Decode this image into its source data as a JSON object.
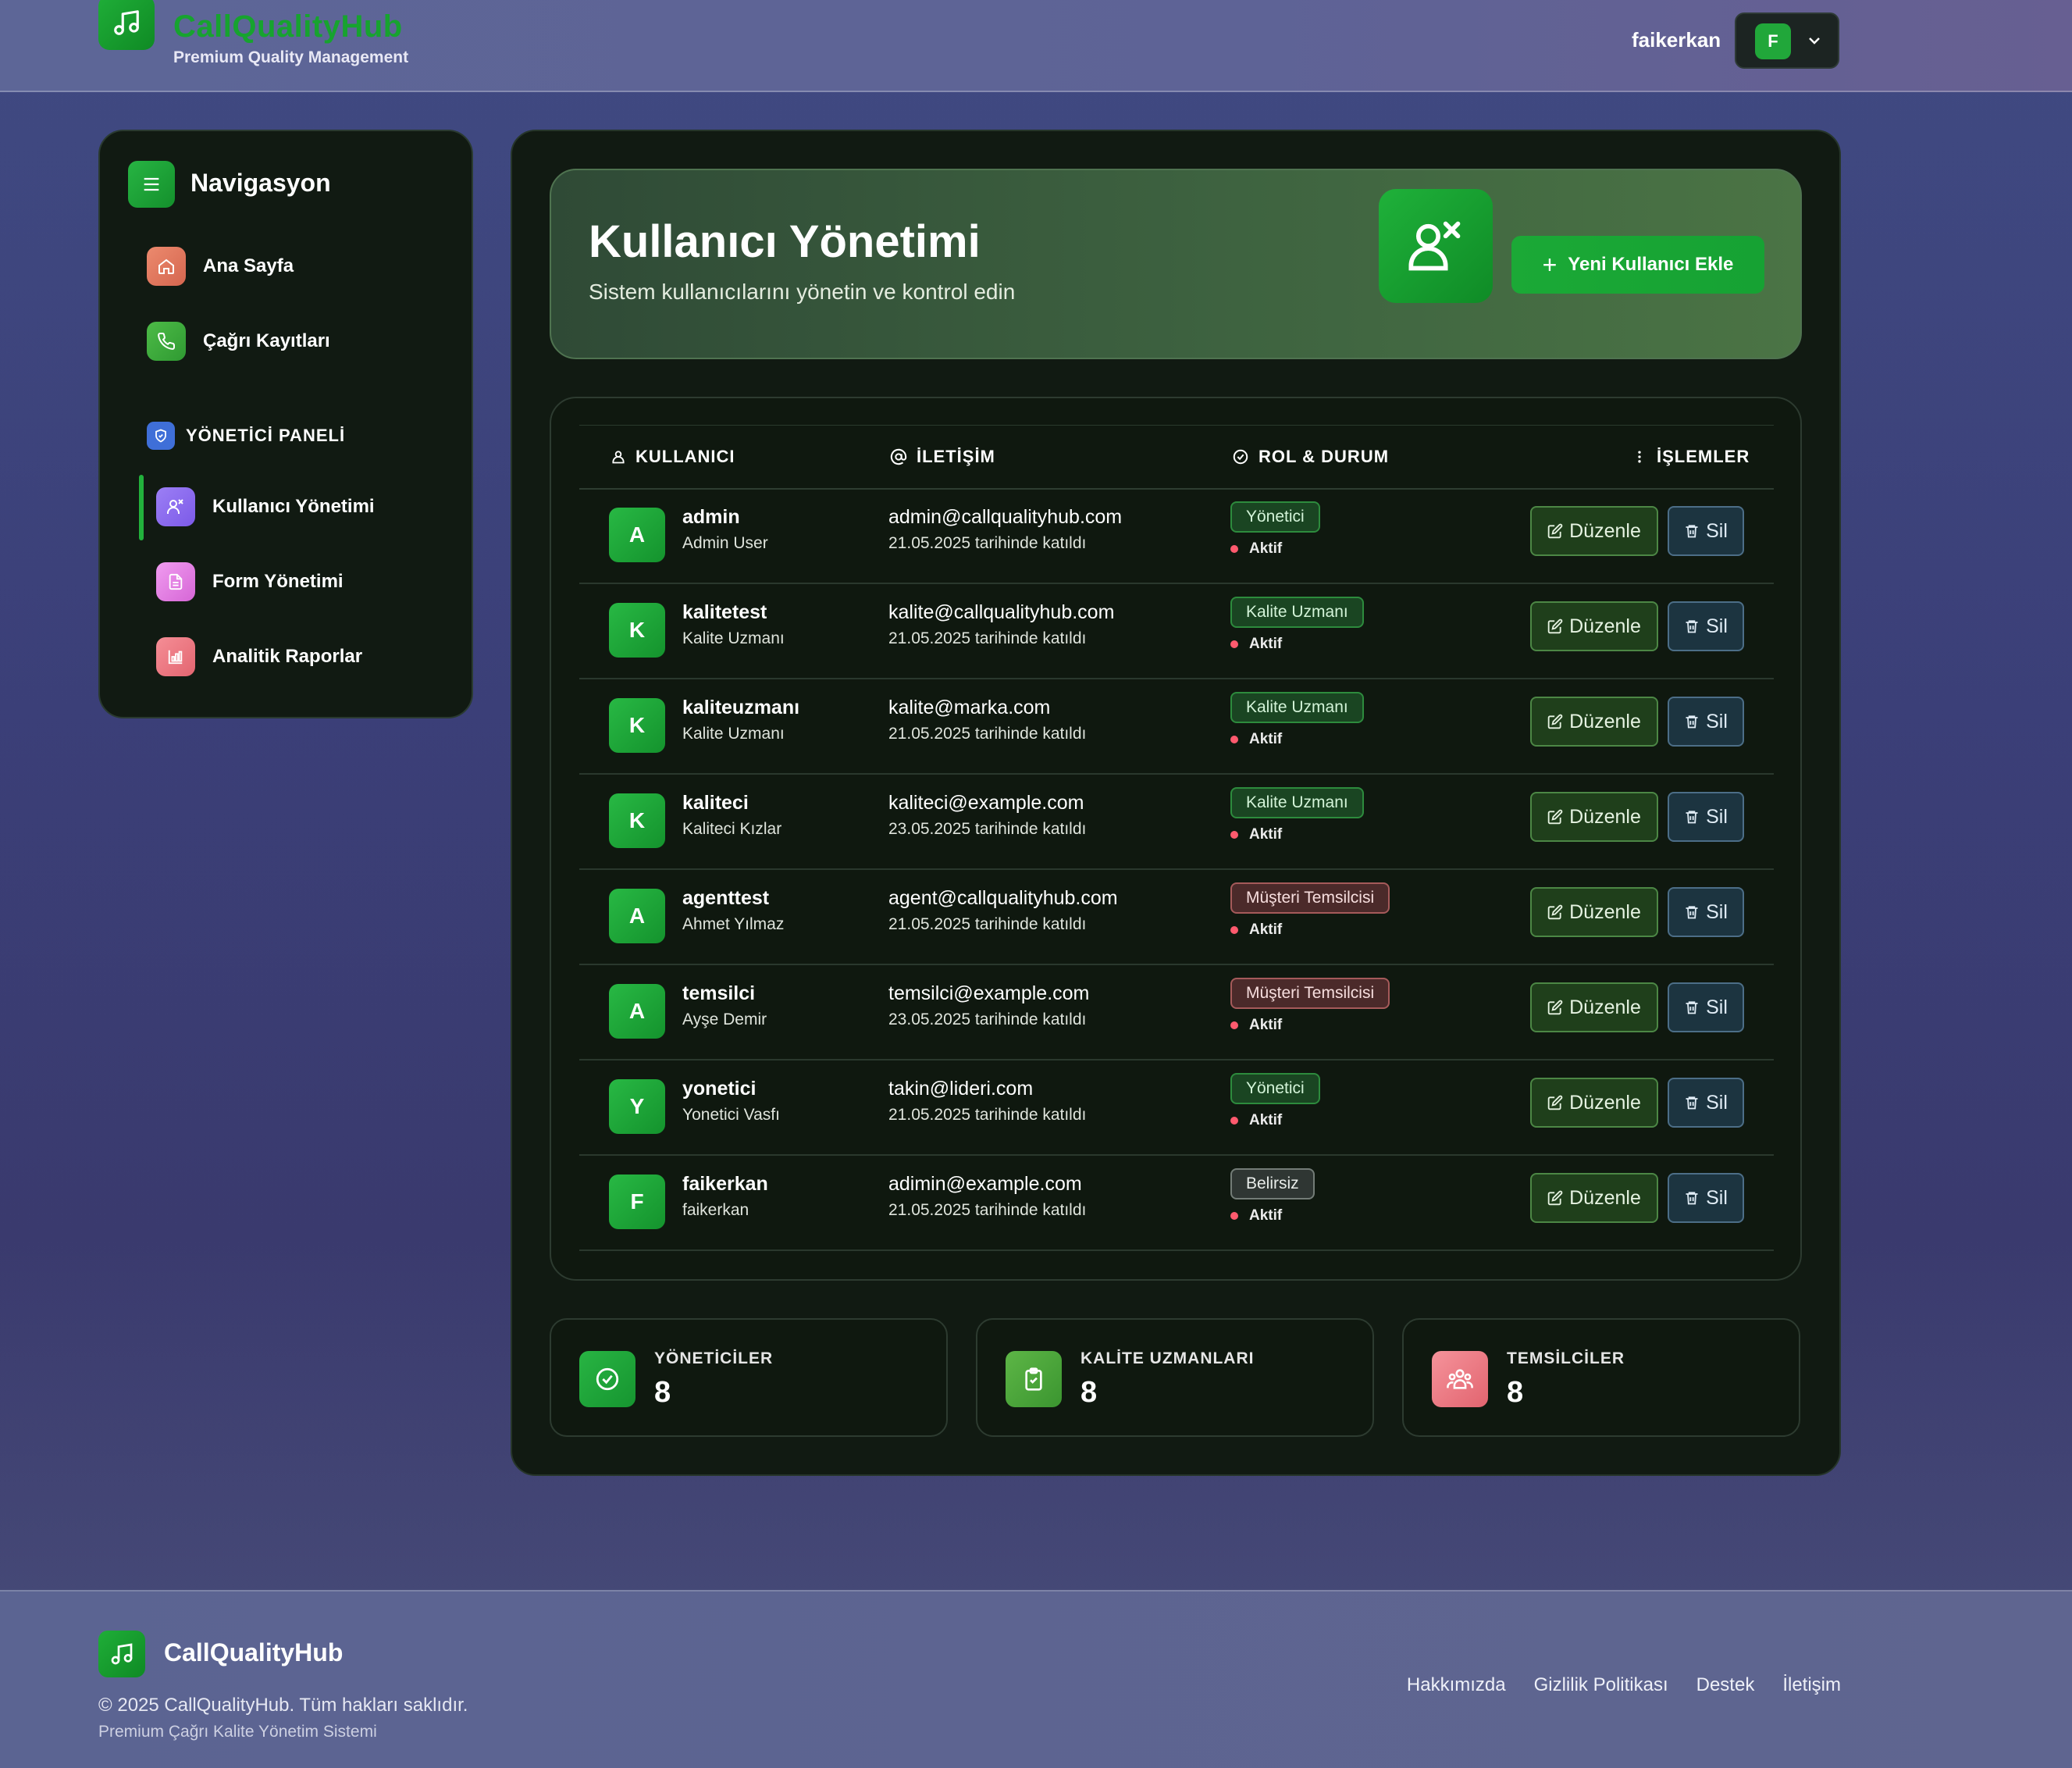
{
  "header": {
    "brand": "CallQualityHub",
    "tagline": "Premium Quality Management",
    "username": "faikerkan",
    "avatar_letter": "F"
  },
  "sidebar": {
    "title": "Navigasyon",
    "items": [
      {
        "label": "Ana Sayfa",
        "icon": "home-icon",
        "color": "#e07a62"
      },
      {
        "label": "Çağrı Kayıtları",
        "icon": "phone-icon",
        "color": "#3daa3e"
      }
    ],
    "section_title": "YÖNETİCİ PANELİ",
    "admin_items": [
      {
        "label": "Kullanıcı Yönetimi",
        "icon": "user-manage-icon",
        "color": "#8b6cf0"
      },
      {
        "label": "Form Yönetimi",
        "icon": "form-icon",
        "color": "#e07be0"
      },
      {
        "label": "Analitik Raporlar",
        "icon": "chart-icon",
        "color": "#ef7b86"
      }
    ]
  },
  "hero": {
    "title": "Kullanıcı Yönetimi",
    "subtitle": "Sistem kullanıcılarını yönetin ve kontrol edin",
    "add_button": "Yeni Kullanıcı Ekle"
  },
  "table": {
    "headers": [
      "KULLANICI",
      "İLETİŞİM",
      "ROL & DURUM",
      "İŞLEMLER"
    ],
    "edit_label": "Düzenle",
    "delete_label": "Sil",
    "rows": [
      {
        "initial": "A",
        "username": "admin",
        "fullname": "Admin User",
        "email": "admin@callqualityhub.com",
        "joined": "21.05.2025 tarihinde katıldı",
        "role": "Yönetici",
        "role_style": "green",
        "status": "Aktif"
      },
      {
        "initial": "K",
        "username": "kalitetest",
        "fullname": "Kalite Uzmanı",
        "email": "kalite@callqualityhub.com",
        "joined": "21.05.2025 tarihinde katıldı",
        "role": "Kalite Uzmanı",
        "role_style": "green",
        "status": "Aktif"
      },
      {
        "initial": "K",
        "username": "kaliteuzmanı",
        "fullname": "Kalite Uzmanı",
        "email": "kalite@marka.com",
        "joined": "21.05.2025 tarihinde katıldı",
        "role": "Kalite Uzmanı",
        "role_style": "green",
        "status": "Aktif"
      },
      {
        "initial": "K",
        "username": "kaliteci",
        "fullname": "Kaliteci Kızlar",
        "email": "kaliteci@example.com",
        "joined": "23.05.2025 tarihinde katıldı",
        "role": "Kalite Uzmanı",
        "role_style": "green",
        "status": "Aktif"
      },
      {
        "initial": "A",
        "username": "agenttest",
        "fullname": "Ahmet Yılmaz",
        "email": "agent@callqualityhub.com",
        "joined": "21.05.2025 tarihinde katıldı",
        "role": "Müşteri Temsilcisi",
        "role_style": "red",
        "status": "Aktif"
      },
      {
        "initial": "A",
        "username": "temsilci",
        "fullname": "Ayşe Demir",
        "email": "temsilci@example.com",
        "joined": "23.05.2025 tarihinde katıldı",
        "role": "Müşteri Temsilcisi",
        "role_style": "red",
        "status": "Aktif"
      },
      {
        "initial": "Y",
        "username": "yonetici",
        "fullname": "Yonetici Vasfı",
        "email": "takin@lideri.com",
        "joined": "21.05.2025 tarihinde katıldı",
        "role": "Yönetici",
        "role_style": "green",
        "status": "Aktif"
      },
      {
        "initial": "F",
        "username": "faikerkan",
        "fullname": "faikerkan",
        "email": "adimin@example.com",
        "joined": "21.05.2025 tarihinde katıldı",
        "role": "Belirsiz",
        "role_style": "gray",
        "status": "Aktif"
      }
    ]
  },
  "stats": [
    {
      "label": "YÖNETİCİLER",
      "value": "8",
      "icon": "shield-check-icon",
      "color": "#23ad3e"
    },
    {
      "label": "KALİTE UZMANLARI",
      "value": "8",
      "icon": "clipboard-icon",
      "color": "#4aa63a"
    },
    {
      "label": "TEMSİLCİLER",
      "value": "8",
      "icon": "users-icon",
      "color": "#f07c85"
    }
  ],
  "footer": {
    "brand": "CallQualityHub",
    "copyright": "© 2025 CallQualityHub. Tüm hakları saklıdır.",
    "subtitle": "Premium Çağrı Kalite Yönetim Sistemi",
    "links": [
      "Hakkımızda",
      "Gizlilik Politikası",
      "Destek",
      "İletişim"
    ]
  }
}
